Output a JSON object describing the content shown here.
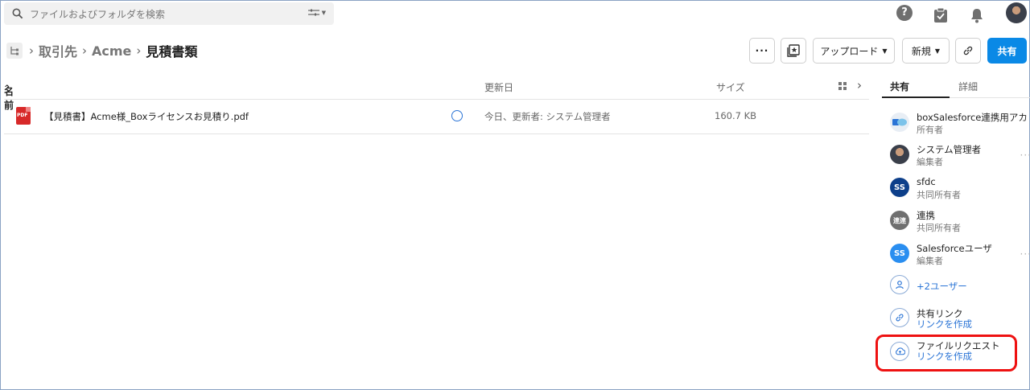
{
  "search": {
    "placeholder": "ファイルおよびフォルダを検索"
  },
  "breadcrumb": {
    "items": [
      "取引先",
      "Acme"
    ],
    "current": "見積書類"
  },
  "toolbar": {
    "more": "···",
    "upload": "アップロード",
    "new": "新規",
    "share": "共有"
  },
  "table": {
    "headers": {
      "name": "名前",
      "sort_indicator": "^",
      "updated": "更新日",
      "size": "サイズ"
    },
    "rows": [
      {
        "icon": "pdf-icon",
        "icon_label": "PDF",
        "name": "【見積書】Acme様_Boxライセンスお見積り.pdf",
        "updated": "今日、更新者: システム管理者",
        "size": "160.7 KB"
      }
    ]
  },
  "sidebar": {
    "tabs": [
      "共有",
      "詳細"
    ],
    "collaborators": [
      {
        "name": "boxSalesforce連携用アカ",
        "role": "所有者",
        "initials": "",
        "color": "#e8eef5"
      },
      {
        "name": "システム管理者",
        "role": "編集者",
        "initials": "",
        "color": "#3a3f4a"
      },
      {
        "name": "sfdc",
        "role": "共同所有者",
        "initials": "SS",
        "color": "#0d3f8a"
      },
      {
        "name": "連携",
        "role": "共同所有者",
        "initials": "連連",
        "color": "#6f6f6f"
      },
      {
        "name": "Salesforceユーザ",
        "role": "編集者",
        "initials": "SS",
        "color": "#2a8ef0"
      }
    ],
    "more_users": "+2ユーザー",
    "shared_link": {
      "title": "共有リンク",
      "action": "リンクを作成"
    },
    "file_request": {
      "title": "ファイルリクエスト",
      "action": "リンクを作成"
    }
  },
  "colors": {
    "accent": "#0a89e6",
    "link": "#2a74d6",
    "highlight": "#ee1111"
  }
}
